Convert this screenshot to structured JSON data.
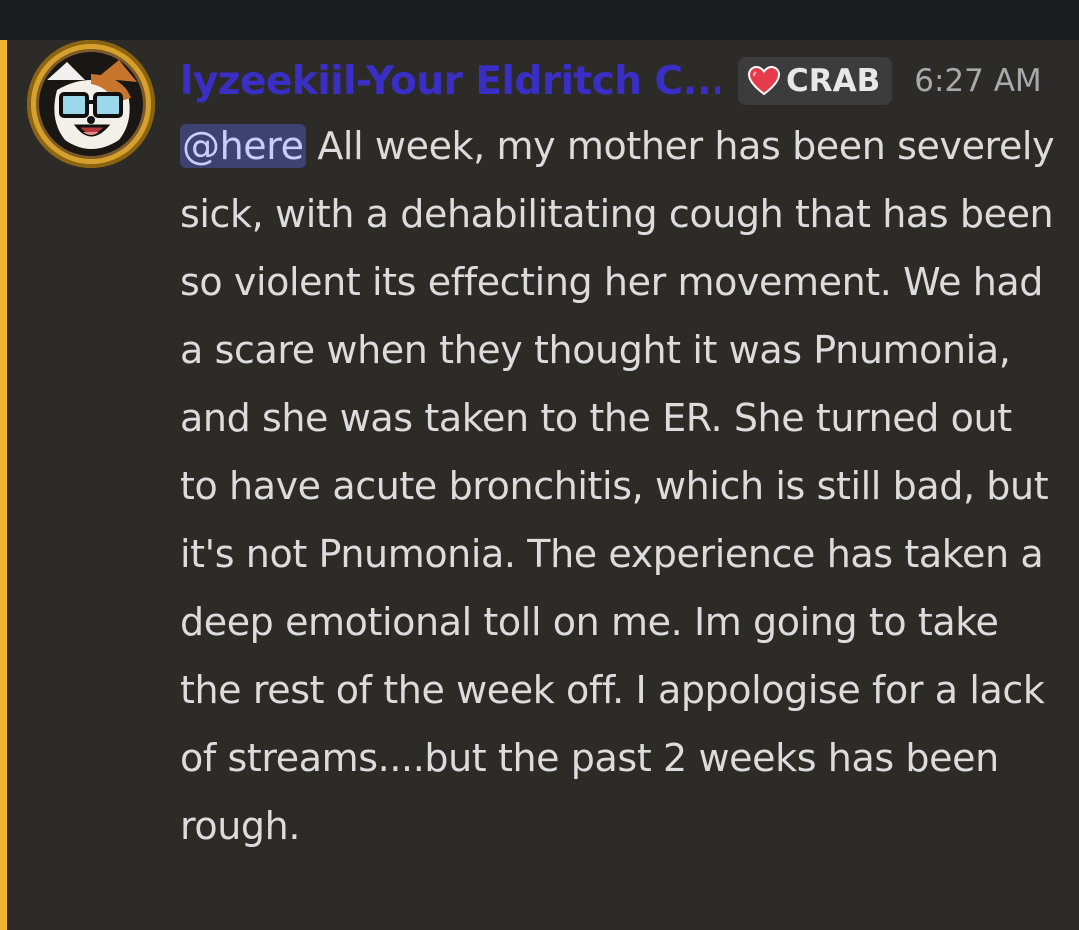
{
  "message": {
    "author": {
      "display_name": "lyzeekiil-Your Eldritch C...",
      "avatar_icon": "fox-avatar-icon",
      "name_color": "#3a2fc4"
    },
    "role_tag": {
      "icon": "heart-icon",
      "label": "CRAB"
    },
    "timestamp": "6:27 AM",
    "mention": "@here",
    "body": " All week, my mother has been severely sick, with a dehabilitating cough that has been so violent its effecting her movement. We had a scare when they thought it was Pnumonia, and she was taken to the ER. She turned out to have acute bronchitis, which is still bad, but it's not Pnumonia. The experience has taken a deep emotional toll on me. Im going to take the rest of the week off. I appologise for a lack of streams....but the past 2 weeks has been rough.",
    "highlight_color": "#f0b232"
  }
}
